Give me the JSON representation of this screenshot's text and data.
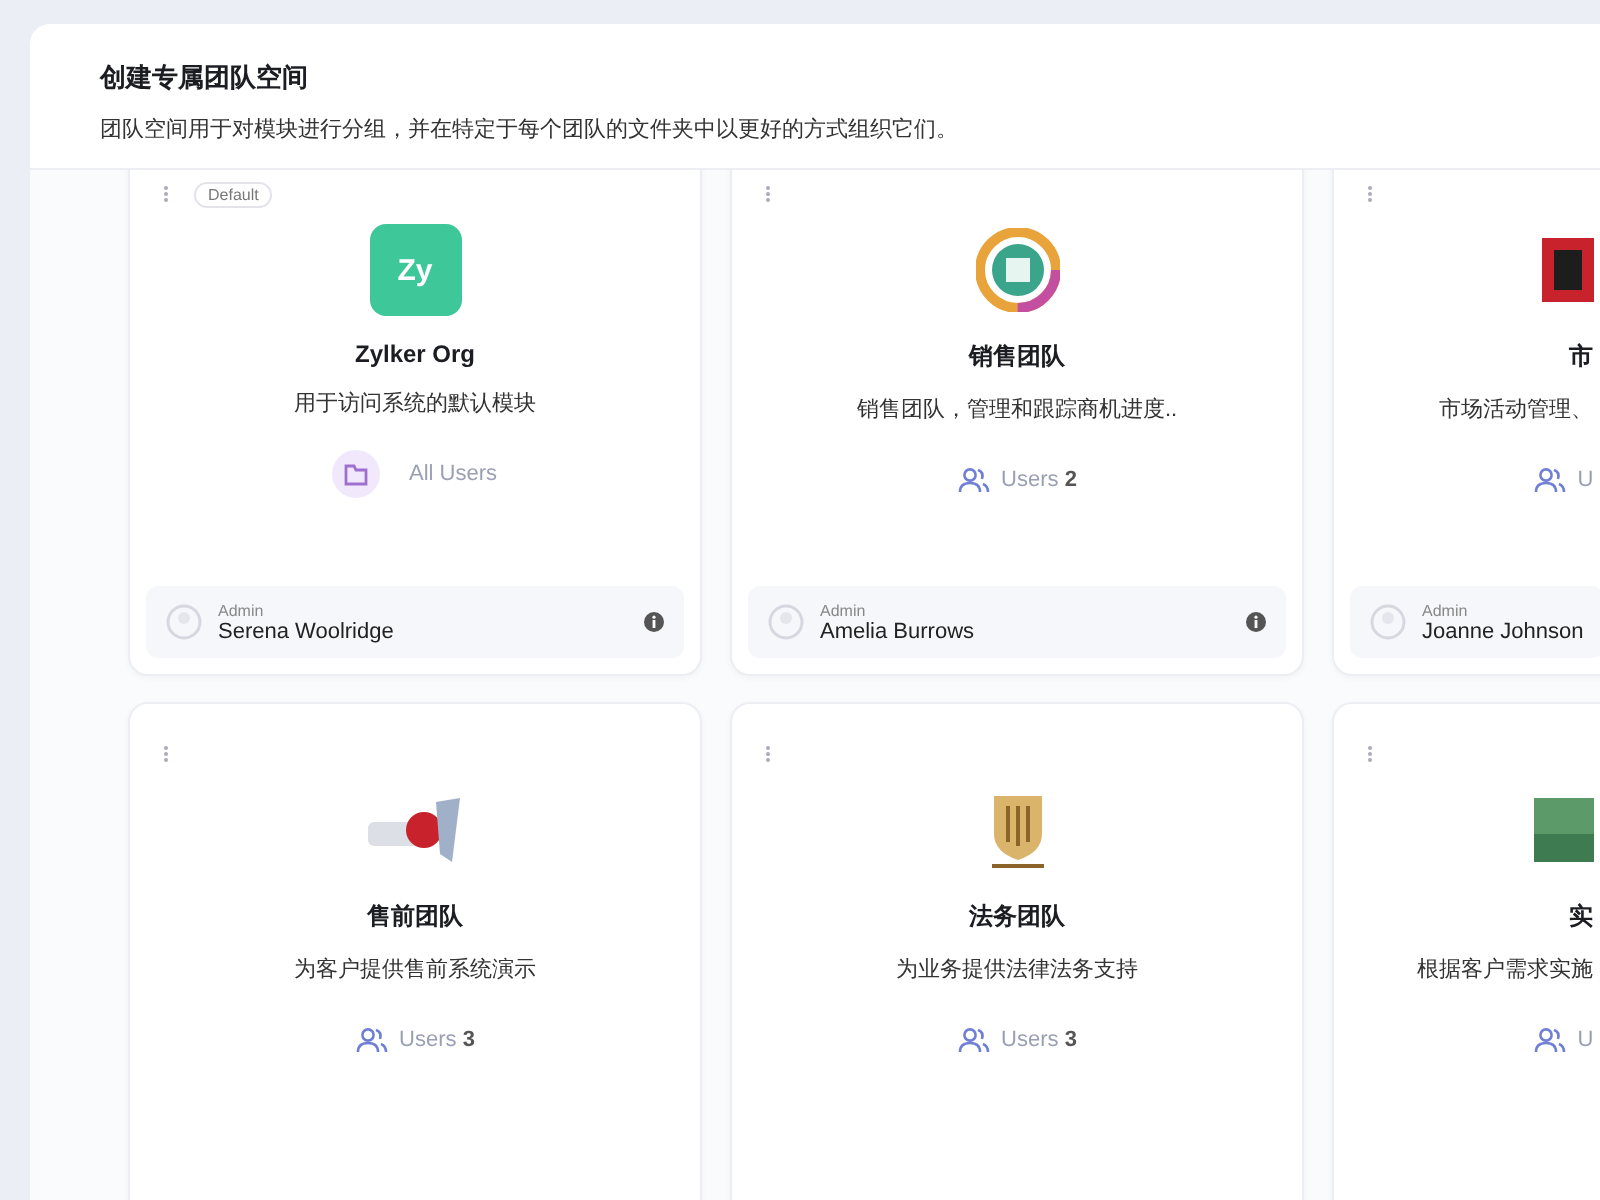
{
  "header": {
    "title": "创建专属团队空间",
    "description": "团队空间用于对模块进行分组，并在特定于每个团队的文件夹中以更好的方式组织它们。"
  },
  "cards": [
    {
      "badge": "Default",
      "logo": {
        "kind": "initials",
        "text": "Zy"
      },
      "name": "Zylker Org",
      "description": "用于访问系统的默认模块",
      "users": {
        "kind": "all",
        "label": "All Users"
      },
      "admin": {
        "label": "Admin",
        "name": "Serena Woolridge"
      }
    },
    {
      "logo": {
        "kind": "ring"
      },
      "name": "销售团队",
      "description": "销售团队，管理和跟踪商机进度..",
      "users": {
        "kind": "count",
        "label": "Users",
        "count": "2"
      },
      "admin": {
        "label": "Admin",
        "name": "Amelia Burrows"
      }
    },
    {
      "logo": {
        "kind": "red"
      },
      "name": "市",
      "description": "市场活动管理、",
      "users": {
        "kind": "count",
        "label": "U"
      },
      "admin": {
        "label": "Admin",
        "name": "Joanne Johnson"
      }
    },
    {
      "logo": {
        "kind": "wine"
      },
      "name": "售前团队",
      "description": "为客户提供售前系统演示",
      "users": {
        "kind": "count",
        "label": "Users",
        "count": "3"
      }
    },
    {
      "logo": {
        "kind": "shield"
      },
      "name": "法务团队",
      "description": "为业务提供法律法务支持",
      "users": {
        "kind": "count",
        "label": "Users",
        "count": "3"
      }
    },
    {
      "logo": {
        "kind": "photo"
      },
      "name": "实",
      "description": "根据客户需求实施",
      "users": {
        "kind": "count",
        "label": "U"
      }
    }
  ]
}
